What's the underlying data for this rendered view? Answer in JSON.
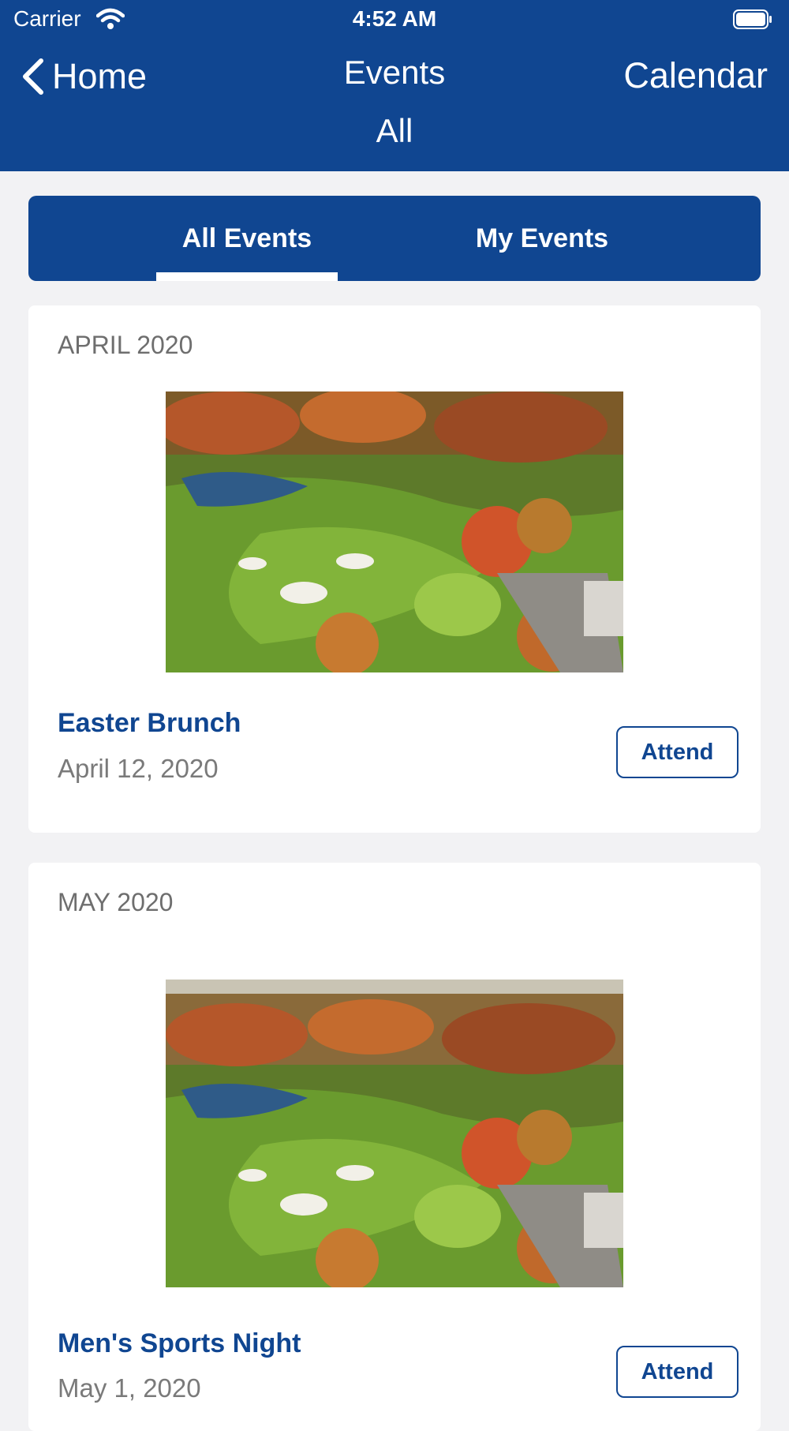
{
  "status_bar": {
    "carrier": "Carrier",
    "time": "4:52 AM"
  },
  "nav": {
    "back_label": "Home",
    "title": "Events",
    "subtitle": "All",
    "calendar_label": "Calendar"
  },
  "tabs": [
    {
      "label": "All Events",
      "selected": true
    },
    {
      "label": "My Events",
      "selected": false
    }
  ],
  "sections": [
    {
      "month": "APRIL 2020",
      "event": {
        "name": "Easter Brunch",
        "date": "April 12, 2020",
        "image_icon": "golf-course-aerial-photo",
        "action_label": "Attend"
      }
    },
    {
      "month": "MAY 2020",
      "event": {
        "name": "Men's Sports Night",
        "date": "May 1, 2020",
        "image_icon": "golf-course-aerial-photo",
        "action_label": "Attend"
      }
    }
  ],
  "colors": {
    "brand": "#104691",
    "background": "#f2f2f4",
    "card": "#ffffff",
    "muted_text": "#6e6e6e"
  }
}
